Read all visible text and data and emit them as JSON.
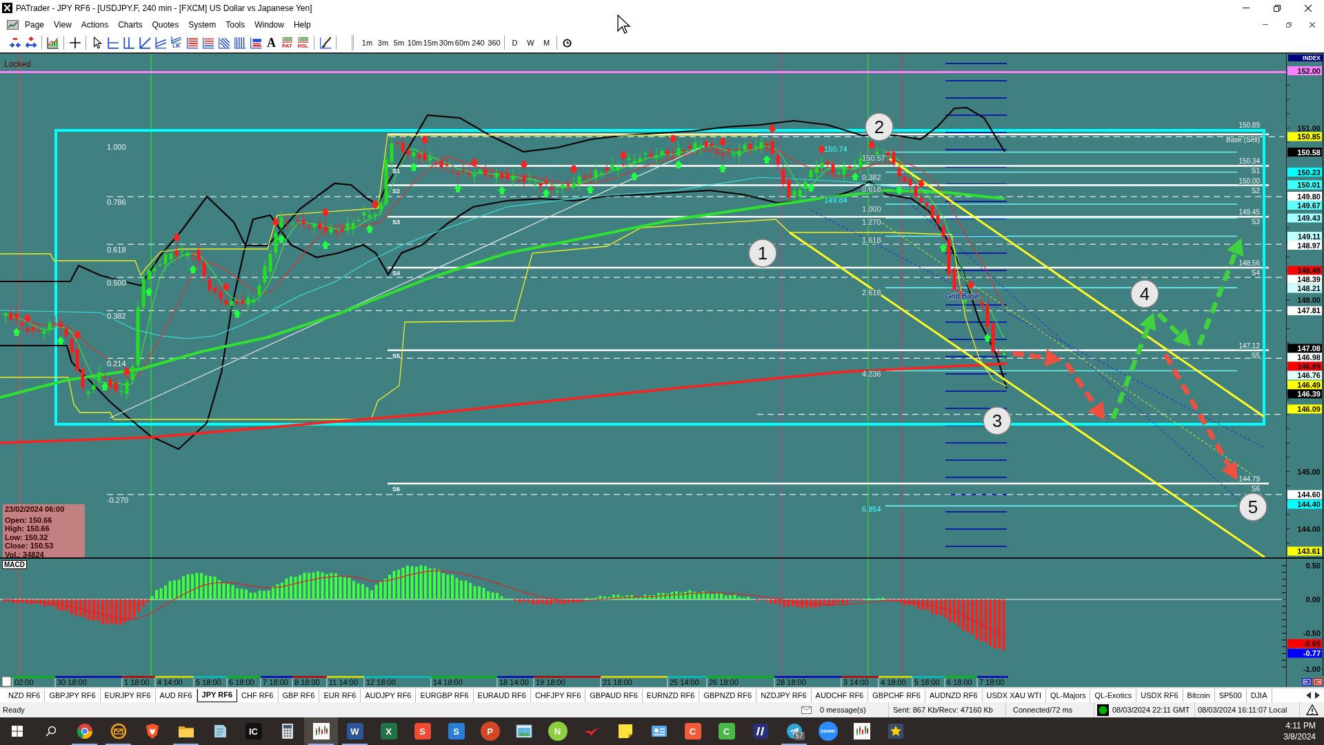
{
  "window": {
    "title": "PATrader - JPY RF6 - [USDJPY.F, 240 min - [FXCM] US Dollar vs Japanese Yen]"
  },
  "menu": [
    "Page",
    "View",
    "Actions",
    "Charts",
    "Quotes",
    "System",
    "Tools",
    "Window",
    "Help"
  ],
  "toolbar": {
    "icon_glyphs": [
      "LR",
      "A",
      "PAT",
      "HSL"
    ],
    "timeframes": [
      "1m",
      "3m",
      "5m",
      "10m",
      "15m",
      "30m",
      "60m",
      "240",
      "360"
    ],
    "periods": [
      "D",
      "W",
      "M"
    ]
  },
  "chart": {
    "lock_label": "Locked",
    "fib_labels": [
      "1.000",
      "0.786",
      "0.618",
      "0.500",
      "0.382",
      "0.214",
      "-0.270"
    ],
    "pivot_tags": [
      "S1",
      "S2",
      "S3",
      "S4",
      "S5",
      "S6"
    ],
    "pivot_prices": [
      {
        "price": "150.89",
        "tag": "Base (Sell)"
      },
      {
        "price": "150.34",
        "tag": "S1"
      },
      {
        "price": "150.00",
        "tag": "S2"
      },
      {
        "price": "149.45",
        "tag": "S3"
      },
      {
        "price": "148.56",
        "tag": "S4"
      },
      {
        "price": "147.12",
        "tag": "S5"
      },
      {
        "price": "144.79",
        "tag": "S6"
      }
    ],
    "extension_labels": [
      {
        "text": "150.74",
        "color": "#40ffff"
      },
      {
        "text": "150.57",
        "color": "#e0e0e0"
      },
      {
        "text": "0.382",
        "color": "#e0e0e0"
      },
      {
        "text": "0.618",
        "color": "#e0e0e0"
      },
      {
        "text": "149.84",
        "color": "#40ffff"
      },
      {
        "text": "1.000",
        "color": "#e0e0e0"
      },
      {
        "text": "1.270",
        "color": "#e0e0e0"
      },
      {
        "text": "1.618",
        "color": "#e0e0e0"
      },
      {
        "text": "2.618",
        "color": "#e0e0e0"
      },
      {
        "text": "4.236",
        "color": "#e0e0e0"
      },
      {
        "text": "6.854",
        "color": "#40ffff"
      }
    ],
    "grid_label": "Grid Base",
    "callouts": [
      "1",
      "2",
      "3",
      "4",
      "5"
    ],
    "bar_info": {
      "date": "23/02/2024 06:00",
      "lines": [
        "Open: 150.66",
        "High: 150.66",
        "Low: 150.32",
        "Close: 150.53",
        "Vol.: 34824"
      ]
    },
    "price_axis": {
      "title": "INDEX",
      "labels": [
        {
          "text": "152.00",
          "kind": "marker",
          "color": "#ff80ff"
        },
        {
          "text": "151.00",
          "kind": "tick"
        },
        {
          "text": "150.85",
          "kind": "marker",
          "color": "#ffff00"
        },
        {
          "text": "150.58",
          "kind": "marker",
          "color": "#000000"
        },
        {
          "text": "150.23",
          "kind": "marker",
          "color": "#00ffff"
        },
        {
          "text": "150.01",
          "kind": "marker",
          "color": "#40ffff"
        },
        {
          "text": "149.80",
          "kind": "marker",
          "color": "#ffffff"
        },
        {
          "text": "149.67",
          "kind": "marker",
          "color": "#60ffff"
        },
        {
          "text": "149.43",
          "kind": "marker",
          "color": "#a0ffff"
        },
        {
          "text": "149.11",
          "kind": "marker",
          "color": "#c0ffff"
        },
        {
          "text": "148.97",
          "kind": "marker",
          "color": "#ffffff"
        },
        {
          "text": "148.48",
          "kind": "marker",
          "color": "#ff0000"
        },
        {
          "text": "148.39",
          "kind": "marker",
          "color": "#ffffff"
        },
        {
          "text": "148.21",
          "kind": "marker",
          "color": "#d0ffff"
        },
        {
          "text": "148.00",
          "kind": "tick"
        },
        {
          "text": "147.81",
          "kind": "marker",
          "color": "#ffffff"
        },
        {
          "text": "147.08",
          "kind": "marker",
          "color": "#000000"
        },
        {
          "text": "146.98",
          "kind": "marker",
          "color": "#ffffff"
        },
        {
          "text": "146.89",
          "kind": "marker",
          "color": "#ff0000"
        },
        {
          "text": "146.76",
          "kind": "marker",
          "color": "#e0ffff"
        },
        {
          "text": "146.49",
          "kind": "marker",
          "color": "#ffff00"
        },
        {
          "text": "146.39",
          "kind": "marker",
          "color": "#000000"
        },
        {
          "text": "146.09",
          "kind": "marker",
          "color": "#ffff00"
        },
        {
          "text": "145.00",
          "kind": "tick"
        },
        {
          "text": "144.60",
          "kind": "marker",
          "color": "#ffffff"
        },
        {
          "text": "144.40",
          "kind": "marker",
          "color": "#00ffff"
        },
        {
          "text": "144.00",
          "kind": "tick"
        },
        {
          "text": "143.61",
          "kind": "marker",
          "color": "#ffff00"
        }
      ]
    }
  },
  "macd": {
    "title": "MACD",
    "axis": [
      {
        "text": "0.50",
        "kind": "tick"
      },
      {
        "text": "0.00",
        "kind": "tick"
      },
      {
        "text": "-0.50",
        "kind": "tick"
      },
      {
        "text": "-0.65",
        "kind": "marker",
        "color": "#ff0000"
      },
      {
        "text": "-0.77",
        "kind": "marker",
        "color": "#0000ff"
      },
      {
        "text": "-1.00",
        "kind": "tick"
      }
    ]
  },
  "time_axis": [
    "02:00",
    "30 18:00",
    "1 18:00",
    "4 14:00",
    "5 18:00",
    "6 18:00",
    "7 18:00",
    "8 18:00",
    "11 14:00",
    "12 18:00",
    "14 18:00",
    "18 14:00",
    "19 18:00",
    "21 18:00",
    "25 14:00",
    "26 18:00",
    "28 18:00",
    "3 14:00",
    "4 18:00",
    "5 18:00",
    "6 18:00",
    "7 18:00"
  ],
  "tabs": [
    {
      "label": "NZD RF6",
      "selected": false
    },
    {
      "label": "GBPJPY RF6",
      "selected": false
    },
    {
      "label": "EURJPY RF6",
      "selected": false
    },
    {
      "label": "AUD RF6",
      "selected": false
    },
    {
      "label": "JPY RF6",
      "selected": true
    },
    {
      "label": "CHF RF6",
      "selected": false
    },
    {
      "label": "GBP RF6",
      "selected": false
    },
    {
      "label": "EUR RF6",
      "selected": false
    },
    {
      "label": "AUDJPY RF6",
      "selected": false
    },
    {
      "label": "EURGBP RF6",
      "selected": false
    },
    {
      "label": "EURAUD RF6",
      "selected": false
    },
    {
      "label": "CHFJPY RF6",
      "selected": false
    },
    {
      "label": "GBPAUD RF6",
      "selected": false
    },
    {
      "label": "EURNZD RF6",
      "selected": false
    },
    {
      "label": "GBPNZD RF6",
      "selected": false
    },
    {
      "label": "NZDJPY RF6",
      "selected": false
    },
    {
      "label": "AUDCHF RF6",
      "selected": false
    },
    {
      "label": "GBPCHF RF6",
      "selected": false
    },
    {
      "label": "AUDNZD RF6",
      "selected": false
    },
    {
      "label": "USDX XAU WTI",
      "selected": false
    },
    {
      "label": "QL-Majors",
      "selected": false
    },
    {
      "label": "QL-Exotics",
      "selected": false
    },
    {
      "label": "USDX RF6",
      "selected": false
    },
    {
      "label": "Bitcoin",
      "selected": false
    },
    {
      "label": "SP500",
      "selected": false
    },
    {
      "label": "DJIA",
      "selected": false
    }
  ],
  "status_bar": {
    "text": "Ready",
    "messages": "0 message(s)",
    "traffic": "Sent: 867 Kb/Recv: 47160 Kb",
    "connection": "Connected/72 ms",
    "connected": true,
    "gmt_time": "08/03/2024 22:11 GMT",
    "local_time": "08/03/2024 16:11:07 Local"
  },
  "taskbar": {
    "apps": [
      {
        "kind": "browser",
        "running": true,
        "selected": false
      },
      {
        "kind": "mail",
        "running": true,
        "selected": false
      },
      {
        "kind": "shield",
        "running": false,
        "selected": false
      },
      {
        "kind": "folder",
        "running": true,
        "selected": false
      },
      {
        "kind": "notebook",
        "running": false,
        "selected": false
      },
      {
        "kind": "tile",
        "glyph": "IC",
        "color": "#111111",
        "running": false,
        "selected": false
      },
      {
        "kind": "calculator",
        "running": false,
        "selected": false
      },
      {
        "kind": "candles",
        "running": true,
        "selected": true
      },
      {
        "kind": "tile",
        "glyph": "W",
        "color": "#2b579a",
        "running": true,
        "selected": false
      },
      {
        "kind": "tile",
        "glyph": "X",
        "color": "#217346",
        "running": false,
        "selected": false
      },
      {
        "kind": "tile",
        "glyph": "S",
        "color": "#f04a32",
        "running": false,
        "selected": false
      },
      {
        "kind": "tile",
        "glyph": "S",
        "color": "#2a7dd6",
        "running": false,
        "selected": false
      },
      {
        "kind": "round",
        "glyph": "P",
        "color": "#d24726",
        "running": false,
        "selected": false
      },
      {
        "kind": "picture",
        "running": false,
        "selected": false
      },
      {
        "kind": "round",
        "glyph": "N",
        "color": "#8ccf3f",
        "running": false,
        "selected": false
      },
      {
        "kind": "bird",
        "running": false,
        "selected": false
      },
      {
        "kind": "sticky",
        "running": false,
        "selected": false
      },
      {
        "kind": "card",
        "running": false,
        "selected": false
      },
      {
        "kind": "tile",
        "glyph": "C",
        "color": "#f25c3a",
        "running": false,
        "selected": false
      },
      {
        "kind": "tile",
        "glyph": "C",
        "color": "#4cb848",
        "running": false,
        "selected": false
      },
      {
        "kind": "slashes",
        "running": false,
        "selected": false
      },
      {
        "kind": "plane",
        "badge": "57",
        "running": true,
        "selected": false
      },
      {
        "kind": "round",
        "glyph": "zoom",
        "color": "#2d8cff",
        "running": false,
        "selected": false
      },
      {
        "kind": "candles",
        "running": false,
        "selected": false
      },
      {
        "kind": "star",
        "running": false,
        "selected": false
      }
    ],
    "time": "4:11 PM",
    "date": "3/8/2024"
  }
}
